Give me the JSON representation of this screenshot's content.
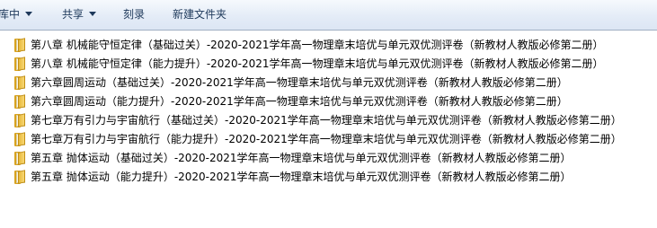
{
  "toolbar": {
    "library_label": "库中",
    "share_label": "共享",
    "burn_label": "刻录",
    "new_folder_label": "新建文件夹"
  },
  "files": [
    {
      "name": "第八章 机械能守恒定律（基础过关）-2020-2021学年高一物理章末培优与单元双优测评卷（新教材人教版必修第二册）",
      "icon": "folder-icon"
    },
    {
      "name": "第八章 机械能守恒定律（能力提升）-2020-2021学年高一物理章末培优与单元双优测评卷（新教材人教版必修第二册）",
      "icon": "folder-icon"
    },
    {
      "name": "第六章圆周运动（基础过关）-2020-2021学年高一物理章末培优与单元双优测评卷（新教材人教版必修第二册）",
      "icon": "folder-icon"
    },
    {
      "name": "第六章圆周运动（能力提升）-2020-2021学年高一物理章末培优与单元双优测评卷（新教材人教版必修第二册）",
      "icon": "folder-icon"
    },
    {
      "name": "第七章万有引力与宇宙航行（基础过关）-2020-2021学年高一物理章末培优与单元双优测评卷（新教材人教版必修第二册）",
      "icon": "folder-icon"
    },
    {
      "name": "第七章万有引力与宇宙航行（能力提升）-2020-2021学年高一物理章末培优与单元双优测评卷（新教材人教版必修第二册）",
      "icon": "folder-icon"
    },
    {
      "name": "第五章  抛体运动（基础过关）-2020-2021学年高一物理章末培优与单元双优测评卷（新教材人教版必修第二册）",
      "icon": "folder-icon"
    },
    {
      "name": "第五章  抛体运动（能力提升）-2020-2021学年高一物理章末培优与单元双优测评卷（新教材人教版必修第二册）",
      "icon": "folder-icon"
    }
  ]
}
